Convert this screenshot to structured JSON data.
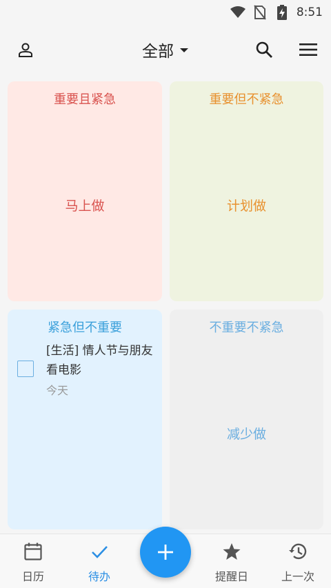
{
  "status_bar": {
    "time": "8:51",
    "icons": [
      "wifi-icon",
      "no-sim-icon",
      "battery-charging-icon"
    ]
  },
  "app_bar": {
    "title": "全部",
    "left_icon": "person-icon",
    "right_icons": [
      "search-icon",
      "menu-icon"
    ],
    "dropdown_icon": "caret-down-icon"
  },
  "quadrants": [
    {
      "title": "重要且紧急",
      "center_label": "马上做",
      "color": "#d9534f",
      "background": "#ffe9e5"
    },
    {
      "title": "重要但不紧急",
      "center_label": "计划做",
      "color": "#e8912f",
      "background": "#eff3e0"
    },
    {
      "title": "紧急但不重要",
      "color": "#3ba0db",
      "background": "#e2f2fe",
      "tasks": [
        {
          "text": "[生活] 情人节与朋友看电影",
          "date": "今天",
          "checked": false
        }
      ]
    },
    {
      "title": "不重要不紧急",
      "center_label": "减少做",
      "color": "#6aaee0",
      "background": "#efefef"
    }
  ],
  "bottom_nav": {
    "items": [
      {
        "label": "日历",
        "icon": "calendar-icon",
        "active": false
      },
      {
        "label": "待办",
        "icon": "check-icon",
        "active": true
      },
      {
        "label": "提醒日",
        "icon": "star-icon",
        "active": false
      },
      {
        "label": "上一次",
        "icon": "history-icon",
        "active": false
      }
    ],
    "fab_icon": "plus-icon",
    "accent": "#2196f3"
  }
}
